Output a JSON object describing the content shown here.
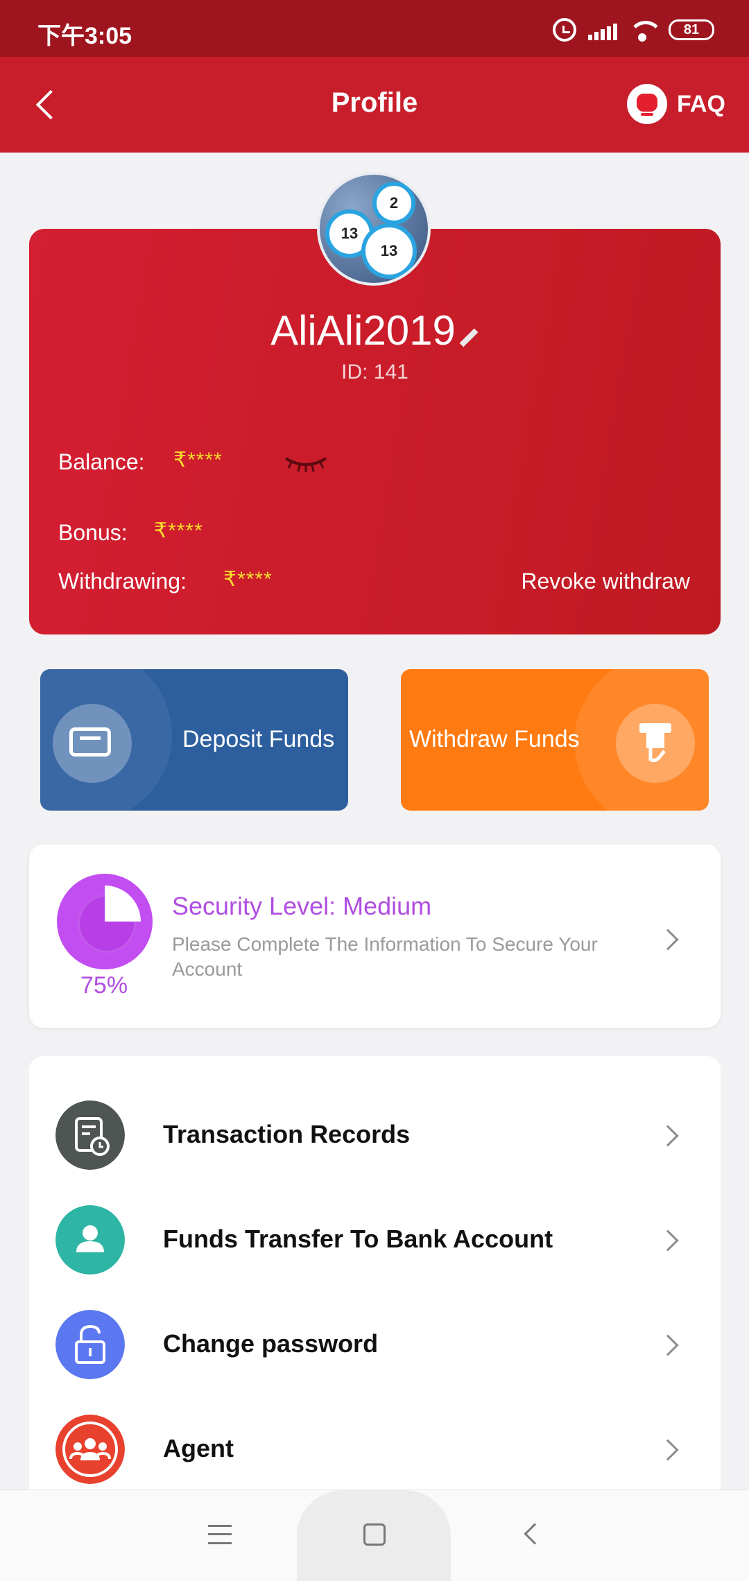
{
  "status_bar": {
    "time": "下午3:05",
    "battery": "81"
  },
  "header": {
    "title": "Profile",
    "faq_label": "FAQ"
  },
  "profile": {
    "username": "AliAli2019",
    "id_text": "ID: 141",
    "balance_label": "Balance:",
    "balance_value": "₹****",
    "bonus_label": "Bonus:",
    "bonus_value": "₹****",
    "withdrawing_label": "Withdrawing:",
    "withdrawing_value": "₹****",
    "revoke_label": "Revoke withdraw",
    "avatar_ball_numbers": [
      "13",
      "13",
      "2"
    ]
  },
  "actions": {
    "deposit_label": "Deposit Funds",
    "withdraw_label": "Withdraw Funds"
  },
  "security": {
    "title": "Security Level: Medium",
    "description": "Please Complete The Information To Secure Your Account",
    "percent": "75%",
    "level_fraction": 0.75
  },
  "menu": {
    "items": [
      {
        "label": "Transaction Records",
        "icon": "records-icon"
      },
      {
        "label": "Funds Transfer To Bank Account",
        "icon": "user-icon"
      },
      {
        "label": "Change password",
        "icon": "lock-icon"
      },
      {
        "label": "Agent",
        "icon": "group-icon"
      }
    ]
  },
  "colors": {
    "header_red": "#c81e2b",
    "card_red": "#d41e32",
    "deposit_blue": "#2d5f9f",
    "withdraw_orange": "#ff7a10",
    "security_purple": "#b04de0",
    "masked_value_yellow": "#f6dc2a",
    "records_icon_bg": "#4f5553",
    "user_icon_bg": "#2eb5a5",
    "lock_icon_bg": "#5b78f0",
    "group_icon_bg": "#e8412e"
  }
}
